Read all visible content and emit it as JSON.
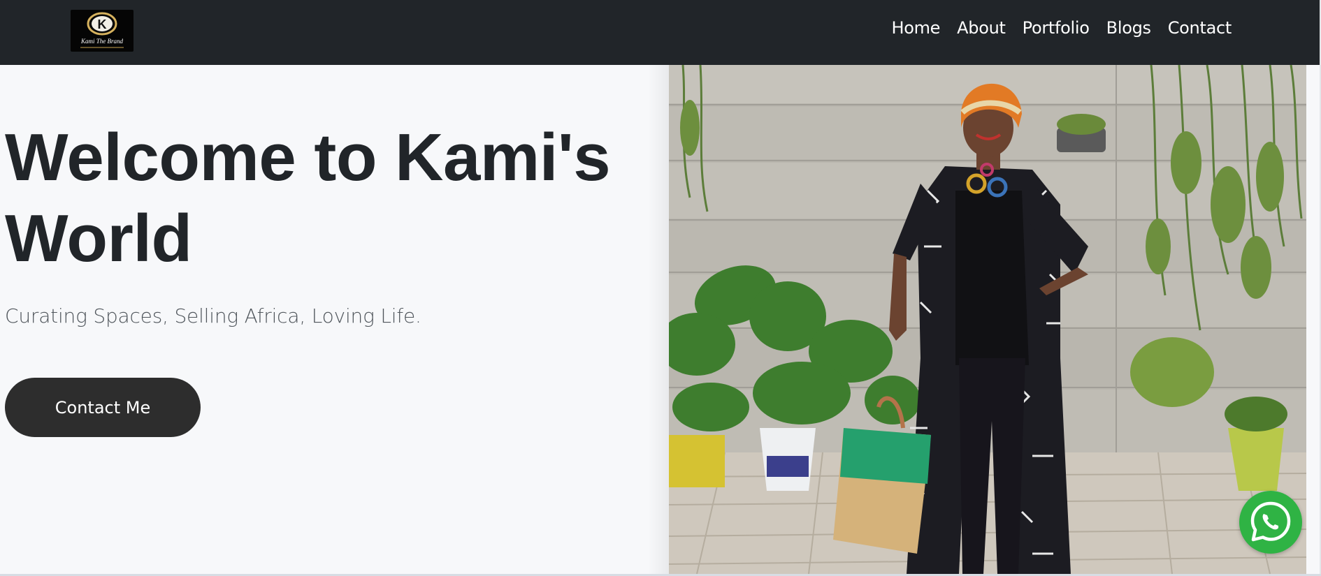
{
  "brand": {
    "logo_letter": "K",
    "logo_script": "Kami The Brand"
  },
  "nav": {
    "items": [
      {
        "label": "Home"
      },
      {
        "label": "About"
      },
      {
        "label": "Portfolio"
      },
      {
        "label": "Blogs"
      },
      {
        "label": "Contact"
      }
    ]
  },
  "hero": {
    "title": "Welcome to Kami's World",
    "subtitle": "Curating Spaces, Selling Africa, Loving Life.",
    "cta_label": "Contact Me",
    "image_icon": "hero-photo"
  },
  "floating": {
    "whatsapp_icon": "whatsapp-icon"
  },
  "colors": {
    "navbar": "#212529",
    "page_bg": "#f7f8fa",
    "title": "#212529",
    "button": "#2d2d2d",
    "whatsapp": "#2fb344"
  }
}
